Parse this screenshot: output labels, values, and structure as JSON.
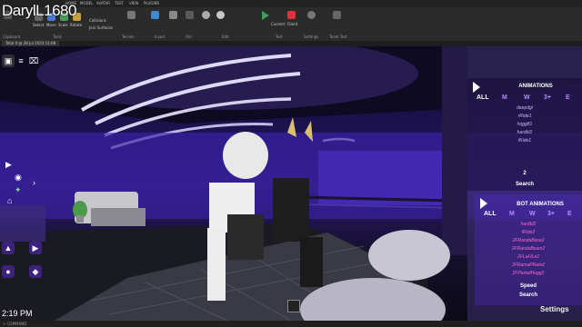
{
  "hud": {
    "player_name": "DarylL1680",
    "clock": "2:19 PM",
    "settings": "Settings"
  },
  "studio": {
    "menu_items": [
      "HOME",
      "MODEL",
      "AVATAR",
      "TEST",
      "VIEW",
      "PLUGINS"
    ],
    "clipboard_label": "Clipboard",
    "tools": [
      "Select",
      "Move",
      "Scale",
      "Rotate"
    ],
    "tools_label": "Tools",
    "terrain_label": "Terrain",
    "insert_label": "Insert",
    "file_label": "File",
    "edit_label": "Edit",
    "test_label": "Test",
    "settings_label": "Settings",
    "team_test_label": "Team Test",
    "collisions_label": "Collisions",
    "join_surfaces_label": "Join Surfaces",
    "current_client_label": "Current: Client",
    "doc_tab": "Total 0 @ 28 Jul 2023 11:08",
    "status": "> COMMAND"
  },
  "animations": {
    "title": "ANIMATIONS",
    "filters": [
      "ALL",
      "M",
      "W",
      "3+",
      "E"
    ],
    "items": [
      "deepdgl",
      "rRide1",
      "hqgg81",
      "hardbl1",
      "fKide1"
    ],
    "page": "2",
    "search": "Search"
  },
  "bot_animations": {
    "title": "BOT ANIMATIONS",
    "filters": [
      "ALL",
      "M",
      "W",
      "3+",
      "E"
    ],
    "items": [
      "hardbl2",
      "fRide2",
      "2FRandaBase2",
      "2FRandaBeam2",
      "2FLaFiLe2",
      "2FRamaPRam2",
      "2FPartialHogg2"
    ],
    "speed": "Speed",
    "search": "Search"
  },
  "colors": {
    "accent_purple": "#7a2cf0",
    "selected_filter": "#ffffff",
    "filter_color": "#b48cff",
    "bot_item": "#ff66cc",
    "anim_item": "#c9b5ff"
  }
}
